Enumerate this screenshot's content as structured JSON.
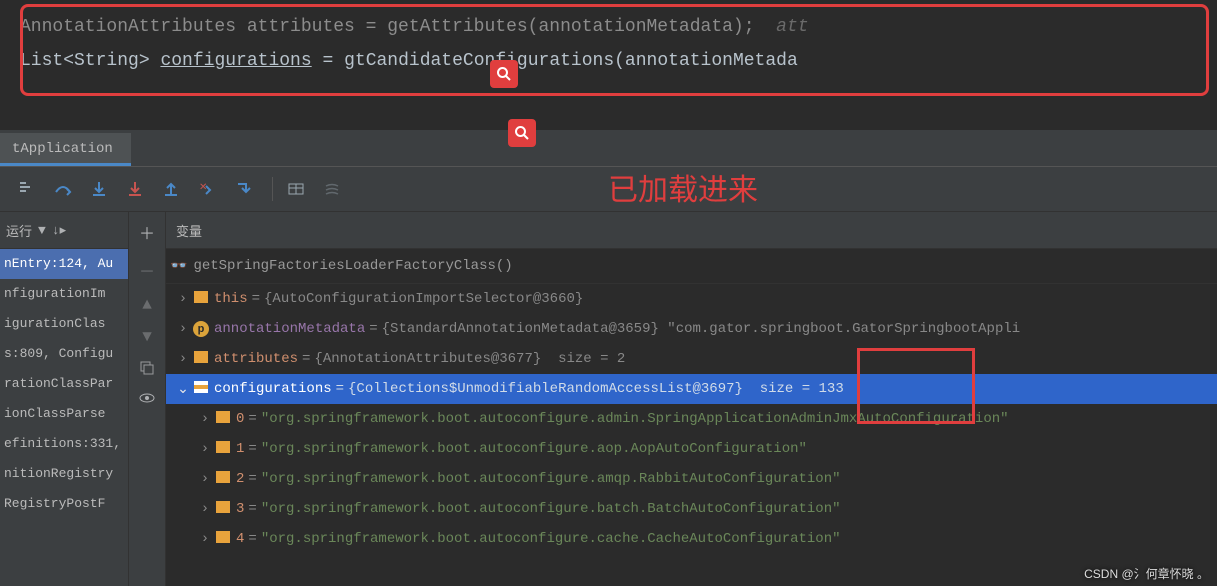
{
  "code": {
    "line1_pre": "AnnotationAttributes attributes = getAttributes(annotationMetadata);",
    "line1_tail": "att",
    "line2_pre": "List<String> ",
    "line2_var": "configurations",
    "line2_mid": " = g",
    "line2_call": "tCandidateConfigurations(annotationMetada"
  },
  "tab": {
    "label": "tApplication"
  },
  "annotation_text": "已加载进来",
  "left": {
    "header": "运行",
    "items": [
      "nEntry:124, Au",
      "nfigurationIm",
      "igurationClas",
      "s:809, Configu",
      "rationClassPar",
      "ionClassParse",
      "efinitions:331,",
      "nitionRegistry",
      "RegistryPostF"
    ],
    "selected_index": 0
  },
  "vars_header": "变量",
  "expr": "getSpringFactoriesLoaderFactoryClass()",
  "vars": [
    {
      "name": "this",
      "val": "{AutoConfigurationImportSelector@3660}",
      "size": "",
      "icon": "bars"
    },
    {
      "name": "annotationMetadata",
      "val": "{StandardAnnotationMetadata@3659}",
      "str": "\"com.gator.springboot.GatorSpringbootAppli",
      "icon": "p"
    },
    {
      "name": "attributes",
      "val": "{AnnotationAttributes@3677}",
      "size": "size = 2",
      "icon": "bars"
    },
    {
      "name": "configurations",
      "val": "{Collections$UnmodifiableRandomAccessList@3697}",
      "size": "size = 133",
      "icon": "bars",
      "selected": true,
      "expanded": true
    }
  ],
  "config_items": [
    {
      "idx": "0",
      "val": "\"org.springframework.boot.autoconfigure.admin.SpringApplicationAdminJmxAutoConfiguration\""
    },
    {
      "idx": "1",
      "val": "\"org.springframework.boot.autoconfigure.aop.AopAutoConfiguration\""
    },
    {
      "idx": "2",
      "val": "\"org.springframework.boot.autoconfigure.amqp.RabbitAutoConfiguration\""
    },
    {
      "idx": "3",
      "val": "\"org.springframework.boot.autoconfigure.batch.BatchAutoConfiguration\""
    },
    {
      "idx": "4",
      "val": "\"org.springframework.boot.autoconfigure.cache.CacheAutoConfiguration\""
    }
  ],
  "watermark": "CSDN @氵何章怀晓 。"
}
